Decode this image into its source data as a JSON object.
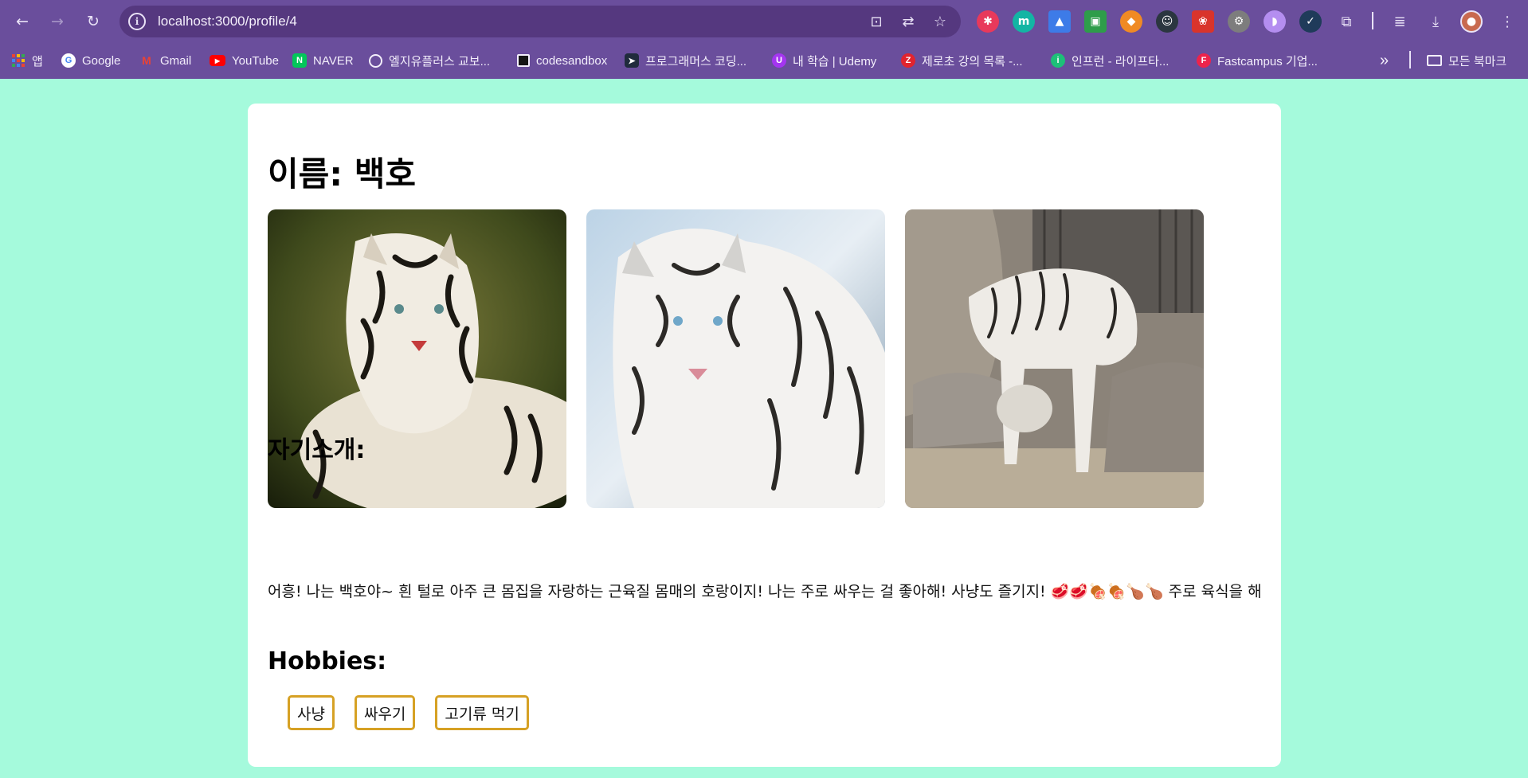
{
  "browser": {
    "url": "localhost:3000/profile/4",
    "bookmarks": [
      {
        "label": "앱",
        "icon": "apps-grid-icon",
        "color": "#f4b400"
      },
      {
        "label": "Google",
        "icon": "google-icon",
        "color": "#ffffff"
      },
      {
        "label": "Gmail",
        "icon": "gmail-icon",
        "color": "#ea4335"
      },
      {
        "label": "YouTube",
        "icon": "youtube-icon",
        "color": "#ff0000"
      },
      {
        "label": "NAVER",
        "icon": "naver-icon",
        "color": "#03c75a"
      },
      {
        "label": "엘지유플러스 교보...",
        "icon": "globe-icon",
        "color": "#ffffff"
      },
      {
        "label": "codesandbox",
        "icon": "codesandbox-icon",
        "color": "#151515"
      },
      {
        "label": "프로그래머스 코딩...",
        "icon": "programmers-icon",
        "color": "#202b3d"
      },
      {
        "label": "내 학습 | Udemy",
        "icon": "udemy-icon",
        "color": "#a435f0"
      },
      {
        "label": "제로초 강의 목록 -...",
        "icon": "zerocho-icon",
        "color": "#e1242f"
      },
      {
        "label": "인프런 - 라이프타...",
        "icon": "inflearn-icon",
        "color": "#1dc078"
      },
      {
        "label": "Fastcampus 기업...",
        "icon": "fastcampus-icon",
        "color": "#ed234b"
      }
    ],
    "all_bookmarks": "모든 북마크",
    "more_bookmarks": "»"
  },
  "profile": {
    "name_title": "이름: 백호",
    "photos": [
      "white-tiger-lying-photo",
      "white-tiger-closeup-photo",
      "white-tiger-zoo-photo"
    ],
    "intro_heading": "자기소개:",
    "intro_text": "어흥! 나는 백호야~ 흰 털로 아주 큰 몸집을 자랑하는 근육질 몸매의 호랑이지! 나는 주로 싸우는 걸 좋아해! 사냥도 즐기지! 🥩🥩🍖🍖🍗🍗 주로 육식을 해",
    "hobbies_heading": "Hobbies:",
    "hobbies": [
      "사냥",
      "싸우기",
      "고기류 먹기"
    ]
  },
  "colors": {
    "page_bg": "#a5fadc",
    "browser_frame": "#6a4e9c",
    "chip_border": "#d6a124"
  }
}
